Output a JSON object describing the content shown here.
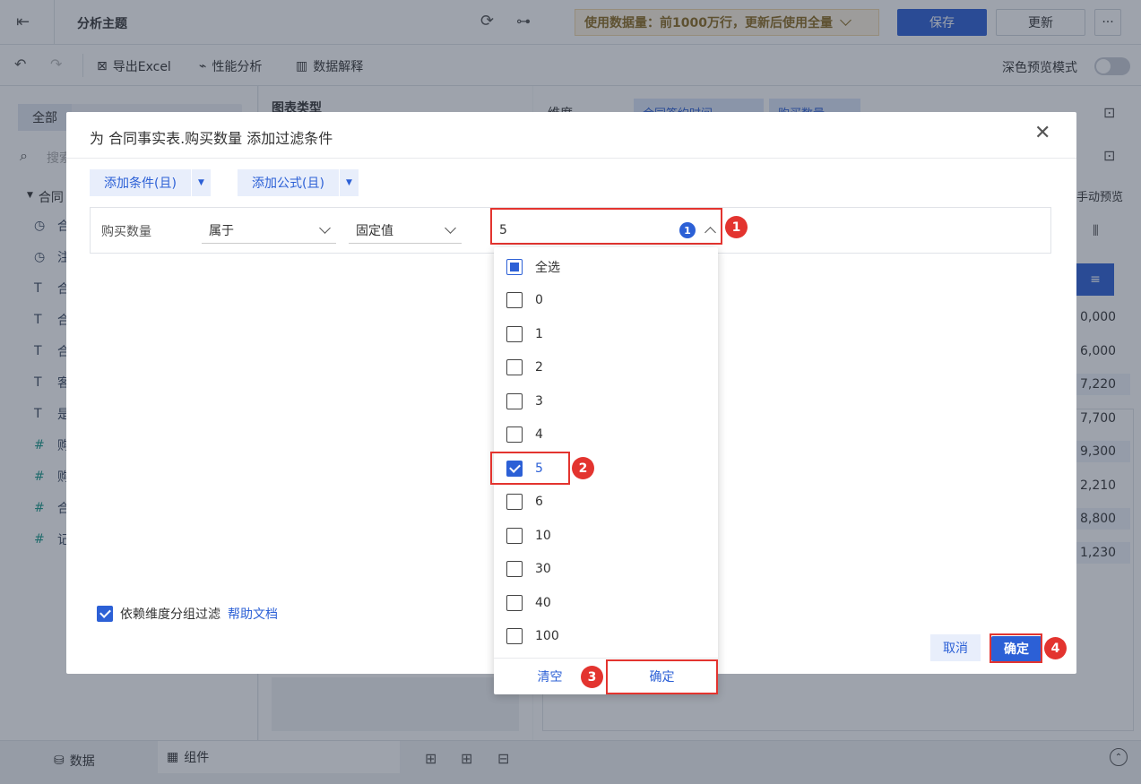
{
  "topbar": {
    "title": "分析主题",
    "data_volume_label": "使用数据量：前1000万行，更新后使用全量",
    "save_label": "保存",
    "update_label": "更新",
    "more_label": "···"
  },
  "toolbar": {
    "export_excel": "导出Excel",
    "perf_analysis": "性能分析",
    "data_explain": "数据解释",
    "dark_preview": "深色预览模式"
  },
  "left_panel": {
    "tab_all": "全部",
    "search_placeholder": "搜索",
    "tree_root": "合同",
    "items": [
      {
        "icon": "clock-icon",
        "label": "合"
      },
      {
        "icon": "clock-icon",
        "label": "注"
      },
      {
        "icon": "text-icon",
        "label": "合"
      },
      {
        "icon": "text-icon",
        "label": "合"
      },
      {
        "icon": "text-icon",
        "label": "合"
      },
      {
        "icon": "text-icon",
        "label": "客"
      },
      {
        "icon": "text-icon",
        "label": "是"
      },
      {
        "icon": "hash-icon",
        "label": "购"
      },
      {
        "icon": "hash-icon",
        "label": "购"
      },
      {
        "icon": "hash-icon",
        "label": "合"
      },
      {
        "icon": "hash-star-icon",
        "label": "记"
      }
    ]
  },
  "middle_panel": {
    "chart_type_label": "图表类型"
  },
  "right_panel": {
    "dimension_label": "维度",
    "dim_chip1": "合同签约时间",
    "dim_chip2": "购买数量",
    "manual_preview": "手动预览",
    "values": [
      "0,000",
      "6,000",
      "7,220",
      "7,700",
      "9,300",
      "2,210",
      "8,800",
      "1,230"
    ]
  },
  "bottom_bar": {
    "data_tab": "数据",
    "component_tab": "组件"
  },
  "dialog": {
    "title": "为 合同事实表.购买数量 添加过滤条件",
    "add_condition": "添加条件(且)",
    "add_formula": "添加公式(且)",
    "field_name": "购买数量",
    "operator": "属于",
    "value_type": "固定值",
    "value_input": "5",
    "selected_count": "1",
    "dependency_checkbox_label": "依赖维度分组过滤",
    "help_link": "帮助文档",
    "cancel_label": "取消",
    "confirm_label": "确定"
  },
  "dropdown": {
    "select_all": "全选",
    "options": [
      {
        "label": "0",
        "checked": false
      },
      {
        "label": "1",
        "checked": false
      },
      {
        "label": "2",
        "checked": false
      },
      {
        "label": "3",
        "checked": false
      },
      {
        "label": "4",
        "checked": false
      },
      {
        "label": "5",
        "checked": true
      },
      {
        "label": "6",
        "checked": false
      },
      {
        "label": "10",
        "checked": false
      },
      {
        "label": "30",
        "checked": false
      },
      {
        "label": "40",
        "checked": false
      },
      {
        "label": "100",
        "checked": false
      }
    ],
    "clear_label": "清空",
    "confirm_label": "确定"
  },
  "annotations": [
    "1",
    "2",
    "3",
    "4"
  ],
  "colors": {
    "primary": "#2c60d6",
    "annotation_red": "#e3342f",
    "data_volume_bg": "#fdf3e0"
  }
}
